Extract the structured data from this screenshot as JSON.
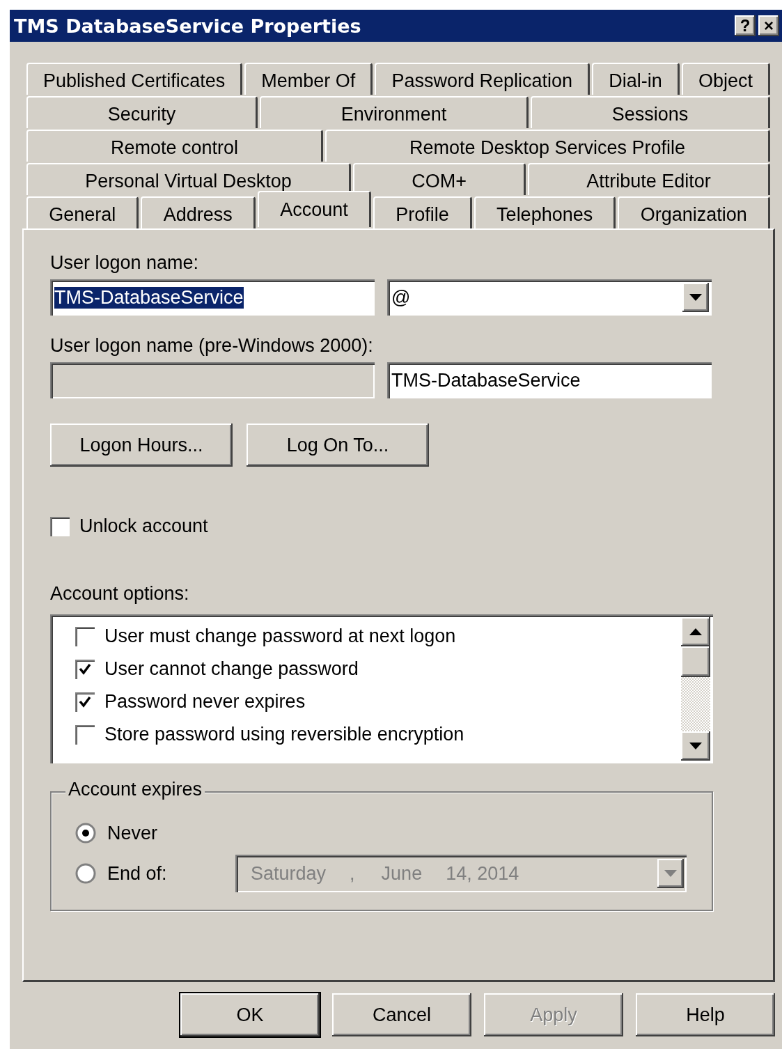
{
  "window": {
    "title": "TMS DatabaseService Properties",
    "title_buttons": [
      "?",
      "×"
    ]
  },
  "tab_rows": [
    [
      {
        "label": "Published Certificates",
        "selected": false
      },
      {
        "label": "Member Of",
        "selected": false
      },
      {
        "label": "Password Replication",
        "selected": false
      },
      {
        "label": "Dial-in",
        "selected": false
      },
      {
        "label": "Object",
        "selected": false
      }
    ],
    [
      {
        "label": "Security",
        "selected": false
      },
      {
        "label": "Environment",
        "selected": false
      },
      {
        "label": "Sessions",
        "selected": false
      }
    ],
    [
      {
        "label": "Remote control",
        "selected": false
      },
      {
        "label": "Remote Desktop Services Profile",
        "selected": false
      }
    ],
    [
      {
        "label": "Personal Virtual Desktop",
        "selected": false
      },
      {
        "label": "COM+",
        "selected": false
      },
      {
        "label": "Attribute Editor",
        "selected": false
      }
    ],
    [
      {
        "label": "General",
        "selected": false
      },
      {
        "label": "Address",
        "selected": false
      },
      {
        "label": "Account",
        "selected": true
      },
      {
        "label": "Profile",
        "selected": false
      },
      {
        "label": "Telephones",
        "selected": false
      },
      {
        "label": "Organization",
        "selected": false
      }
    ]
  ],
  "logon_name": {
    "label": "User logon name:",
    "value": "TMS-DatabaseService",
    "text_selected": true,
    "domain": "@"
  },
  "pre2000": {
    "label": "User logon name (pre-Windows 2000):",
    "domain_disabled": true,
    "value": "TMS-DatabaseService"
  },
  "action_buttons": [
    "Logon Hours...",
    "Log On To..."
  ],
  "unlock": {
    "label": "Unlock account",
    "checked": false
  },
  "account_options": {
    "label": "Account options:",
    "items": [
      {
        "label": "User must change password at next logon",
        "checked": false
      },
      {
        "label": "User cannot change password",
        "checked": true
      },
      {
        "label": "Password never expires",
        "checked": true
      },
      {
        "label": "Store password using reversible encryption",
        "checked": false
      }
    ]
  },
  "account_expires": {
    "label": "Account expires",
    "options": [
      {
        "label": "Never",
        "selected": true
      },
      {
        "label": "End of:",
        "selected": false
      }
    ],
    "date_disabled": true,
    "date_parts": [
      "Saturday",
      ",",
      "June",
      "14, 2014"
    ]
  },
  "buttons": [
    {
      "label": "OK",
      "default": true,
      "disabled": false
    },
    {
      "label": "Cancel",
      "default": false,
      "disabled": false
    },
    {
      "label": "Apply",
      "default": false,
      "disabled": true
    },
    {
      "label": "Help",
      "default": false,
      "disabled": false
    }
  ]
}
